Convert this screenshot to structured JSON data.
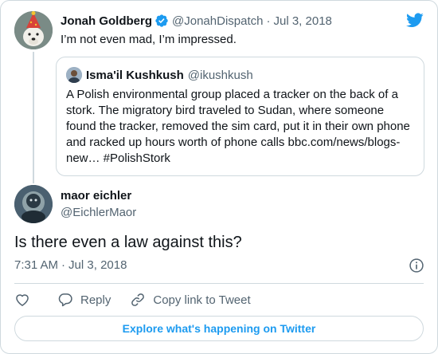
{
  "parent_tweet": {
    "author_name": "Jonah Goldberg",
    "author_handle": "@JonahDispatch",
    "separator": "·",
    "date": "Jul 3, 2018",
    "text": "I’m not even mad, I’m impressed."
  },
  "quoted_tweet": {
    "author_name": "Isma'il Kushkush",
    "author_handle": "@ikushkush",
    "text": "A Polish environmental group placed a tracker on the back of a stork. The migratory bird traveled to Sudan, where someone found the tracker, removed the sim card, put it in their own phone and racked up hours worth of phone calls bbc.com/news/blogs-new… #PolishStork"
  },
  "main_tweet": {
    "author_name": "maor eichler",
    "author_handle": "@EichlerMaor",
    "text": "Is there even a law against this?",
    "time": "7:31 AM",
    "separator": "·",
    "date": "Jul 3, 2018"
  },
  "actions": {
    "reply_label": "Reply",
    "copy_link_label": "Copy link to Tweet"
  },
  "explore_label": "Explore what's happening on Twitter",
  "icons": {
    "brand": "twitter-bird-icon",
    "verified": "verified-badge-icon",
    "info": "info-icon",
    "like": "heart-icon",
    "reply": "reply-bubble-icon",
    "link": "link-icon"
  },
  "colors": {
    "accent": "#1d9bf0",
    "text": "#0f1419",
    "secondary": "#536471",
    "border": "#cfd9de"
  }
}
